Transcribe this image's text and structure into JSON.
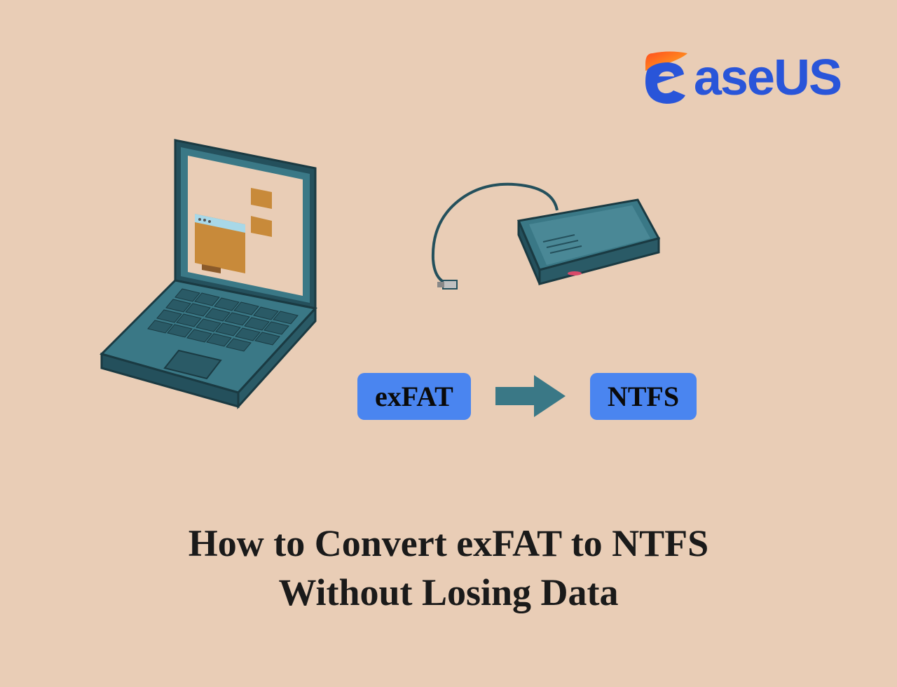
{
  "logo": {
    "brand_text": "aseUS"
  },
  "badges": {
    "from": "exFAT",
    "to": "NTFS"
  },
  "title_line1": "How to Convert exFAT to NTFS",
  "title_line2": "Without Losing Data",
  "colors": {
    "background": "#e9cdb6",
    "accent_blue": "#4a85f0",
    "brand_blue": "#2955d9",
    "teal": "#3a7886",
    "dark_teal": "#24505c",
    "orange": "#ff8b1f"
  }
}
